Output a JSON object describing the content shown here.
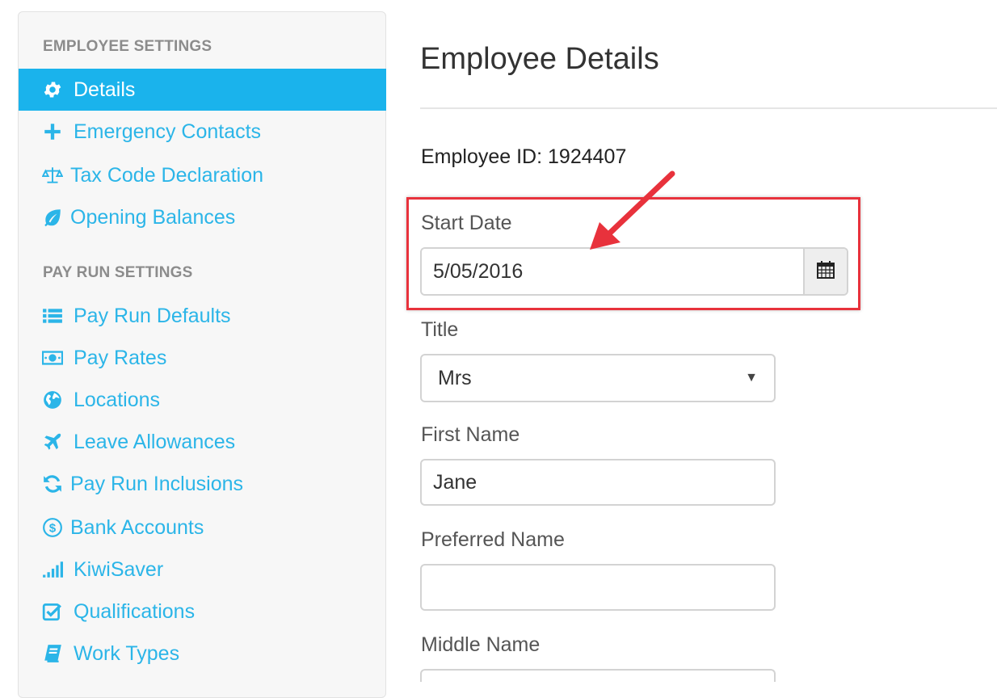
{
  "sidebar": {
    "employee_heading": "EMPLOYEE SETTINGS",
    "payrun_heading": "PAY RUN SETTINGS",
    "employee_items": [
      {
        "label": "Details",
        "icon": "gear-icon",
        "active": true
      },
      {
        "label": "Emergency Contacts",
        "icon": "plus-icon"
      },
      {
        "label": "Tax Code Declaration",
        "icon": "scales-icon"
      },
      {
        "label": "Opening Balances",
        "icon": "leaf-icon"
      }
    ],
    "payrun_items": [
      {
        "label": "Pay Run Defaults",
        "icon": "list-icon"
      },
      {
        "label": "Pay Rates",
        "icon": "money-icon"
      },
      {
        "label": "Locations",
        "icon": "globe-icon"
      },
      {
        "label": "Leave Allowances",
        "icon": "plane-icon"
      },
      {
        "label": "Pay Run Inclusions",
        "icon": "refresh-icon"
      },
      {
        "label": "Bank Accounts",
        "icon": "dollar-circle-icon"
      },
      {
        "label": "KiwiSaver",
        "icon": "signal-icon"
      },
      {
        "label": "Qualifications",
        "icon": "checkbox-icon"
      },
      {
        "label": "Work Types",
        "icon": "book-icon"
      }
    ]
  },
  "main": {
    "title": "Employee Details",
    "employee_id_label": "Employee ID:",
    "employee_id_value": "1924407",
    "start_date_label": "Start Date",
    "start_date_value": "5/05/2016",
    "title_label": "Title",
    "title_value": "Mrs",
    "first_name_label": "First Name",
    "first_name_value": "Jane",
    "preferred_name_label": "Preferred Name",
    "preferred_name_value": "",
    "middle_name_label": "Middle Name",
    "middle_name_value": ""
  },
  "colors": {
    "accent": "#1ab3ec",
    "link": "#2bb5e8",
    "annotation": "#e8323c"
  }
}
